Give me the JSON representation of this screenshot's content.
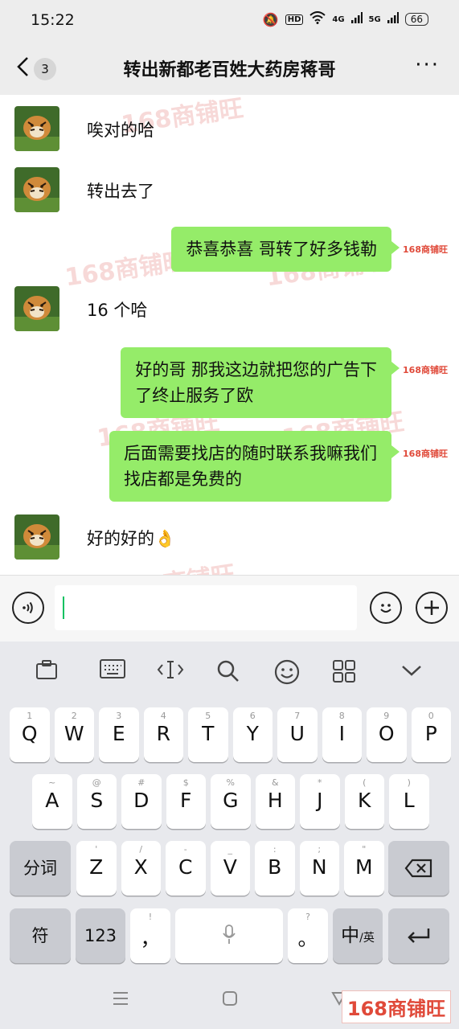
{
  "status": {
    "time": "15:22",
    "hd": "HD",
    "net1": "4G",
    "net2": "5G",
    "battery": "66"
  },
  "header": {
    "back_count": "3",
    "title": "转出新都老百姓大药房蒋哥",
    "more": "···"
  },
  "watermark": "168商铺旺",
  "messages": [
    {
      "side": "left",
      "text": "唉对的哈"
    },
    {
      "side": "left",
      "text": "转出去了"
    },
    {
      "side": "right",
      "text": "恭喜恭喜  哥转了好多钱勒"
    },
    {
      "side": "left",
      "text": "16 个哈"
    },
    {
      "side": "right",
      "line1": "好的哥 那我这边就把您的广告下",
      "line2": "了终止服务了欧"
    },
    {
      "side": "right",
      "line1": "后面需要找店的随时联系我嘛我们",
      "line2": "找店都是免费的"
    },
    {
      "side": "left",
      "text": "好的好的👌"
    }
  ],
  "avatar_logo": "168商铺旺",
  "input": {
    "value": ""
  },
  "keyboard": {
    "row1": [
      {
        "sub": "1",
        "key": "Q"
      },
      {
        "sub": "2",
        "key": "W"
      },
      {
        "sub": "3",
        "key": "E"
      },
      {
        "sub": "4",
        "key": "R"
      },
      {
        "sub": "5",
        "key": "T"
      },
      {
        "sub": "6",
        "key": "Y"
      },
      {
        "sub": "7",
        "key": "U"
      },
      {
        "sub": "8",
        "key": "I"
      },
      {
        "sub": "9",
        "key": "O"
      },
      {
        "sub": "0",
        "key": "P"
      }
    ],
    "row2": [
      {
        "sub": "~",
        "key": "A"
      },
      {
        "sub": "@",
        "key": "S"
      },
      {
        "sub": "#",
        "key": "D"
      },
      {
        "sub": "$",
        "key": "F"
      },
      {
        "sub": "%",
        "key": "G"
      },
      {
        "sub": "&",
        "key": "H"
      },
      {
        "sub": "*",
        "key": "J"
      },
      {
        "sub": "(",
        "key": "K"
      },
      {
        "sub": ")",
        "key": "L"
      }
    ],
    "row3": [
      {
        "sub": "'",
        "key": "Z"
      },
      {
        "sub": "/",
        "key": "X"
      },
      {
        "sub": "-",
        "key": "C"
      },
      {
        "sub": "_",
        "key": "V"
      },
      {
        "sub": ":",
        "key": "B"
      },
      {
        "sub": ";",
        "key": "N"
      },
      {
        "sub": "\"",
        "key": "M"
      }
    ],
    "fenci": "分词",
    "fu": "符",
    "num": "123",
    "comma_sub": "!",
    "comma": "，",
    "period_sub": "?",
    "period": "。",
    "zh": "中",
    "en": "/英"
  },
  "icon_colors": {
    "bubble": "#95ec69",
    "accent": "#07c160"
  }
}
